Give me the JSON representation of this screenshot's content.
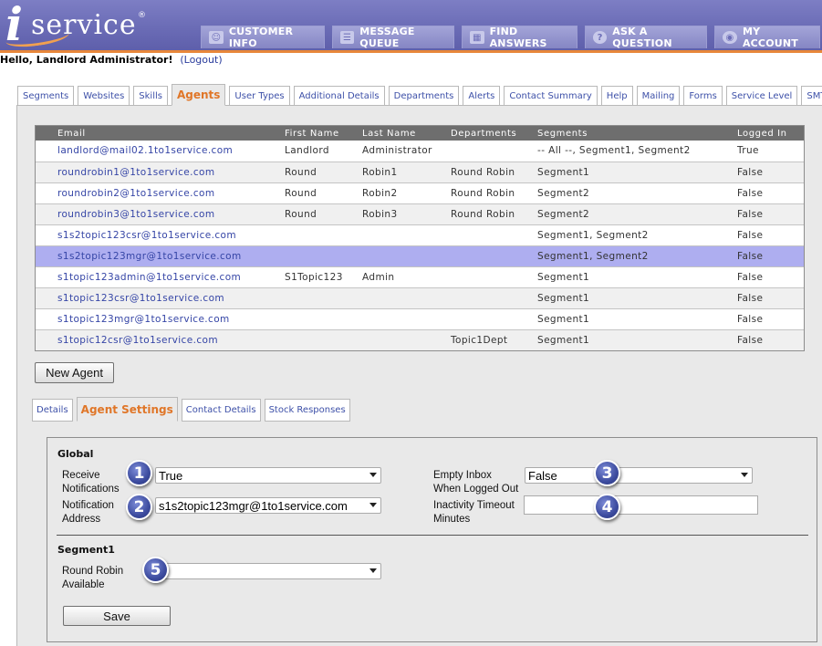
{
  "header": {
    "logo_i": "i",
    "logo_text": "service",
    "logo_reg": "®",
    "nav": [
      {
        "label": "CUSTOMER INFO",
        "icon": "people-icon"
      },
      {
        "label": "MESSAGE QUEUE",
        "icon": "document-icon"
      },
      {
        "label": "FIND ANSWERS",
        "icon": "book-icon"
      },
      {
        "label": "ASK A QUESTION",
        "icon": "question-icon"
      },
      {
        "label": "MY ACCOUNT",
        "icon": "eye-icon"
      }
    ],
    "greeting": "Hello, Landlord Administrator!",
    "logout_open": "(",
    "logout_label": "Logout",
    "logout_close": ")"
  },
  "tabs": [
    {
      "label": "Segments"
    },
    {
      "label": "Websites"
    },
    {
      "label": "Skills"
    },
    {
      "label": "Agents",
      "active": true
    },
    {
      "label": "User Types"
    },
    {
      "label": "Additional Details"
    },
    {
      "label": "Departments"
    },
    {
      "label": "Alerts"
    },
    {
      "label": "Contact Summary"
    },
    {
      "label": "Help"
    },
    {
      "label": "Mailing"
    },
    {
      "label": "Forms"
    },
    {
      "label": "Service Level"
    },
    {
      "label": "SMTP Out"
    }
  ],
  "table": {
    "columns": [
      "Email",
      "First Name",
      "Last Name",
      "Departments",
      "Segments",
      "Logged In"
    ],
    "rows": [
      [
        "landlord@mail02.1to1service.com",
        "Landlord",
        "Administrator",
        "",
        "-- All --, Segment1, Segment2",
        "True"
      ],
      [
        "roundrobin1@1to1service.com",
        "Round",
        "Robin1",
        "Round Robin",
        "Segment1",
        "False"
      ],
      [
        "roundrobin2@1to1service.com",
        "Round",
        "Robin2",
        "Round Robin",
        "Segment2",
        "False"
      ],
      [
        "roundrobin3@1to1service.com",
        "Round",
        "Robin3",
        "Round Robin",
        "Segment2",
        "False"
      ],
      [
        "s1s2topic123csr@1to1service.com",
        "",
        "",
        "",
        "Segment1, Segment2",
        "False"
      ],
      [
        "s1s2topic123mgr@1to1service.com",
        "",
        "",
        "",
        "Segment1, Segment2",
        "False"
      ],
      [
        "s1topic123admin@1to1service.com",
        "S1Topic123",
        "Admin",
        "",
        "Segment1",
        "False"
      ],
      [
        "s1topic123csr@1to1service.com",
        "",
        "",
        "",
        "Segment1",
        "False"
      ],
      [
        "s1topic123mgr@1to1service.com",
        "",
        "",
        "",
        "Segment1",
        "False"
      ],
      [
        "s1topic12csr@1to1service.com",
        "",
        "",
        "Topic1Dept",
        "Segment1",
        "False"
      ]
    ],
    "selected_row": 5
  },
  "new_agent_label": "New Agent",
  "subtabs": [
    {
      "label": "Details"
    },
    {
      "label": "Agent Settings",
      "active": true
    },
    {
      "label": "Contact Details"
    },
    {
      "label": "Stock Responses"
    }
  ],
  "settings": {
    "global_title": "Global",
    "receive_notifications_label_1": "Receive",
    "receive_notifications_label_2": "Notifications",
    "receive_notifications_value": "True",
    "notification_address_label_1": "Notification",
    "notification_address_label_2": "Address",
    "notification_address_value": "s1s2topic123mgr@1to1service.com",
    "empty_inbox_label_1": "Empty Inbox",
    "empty_inbox_label_2": "When Logged Out",
    "empty_inbox_value": "False",
    "inactivity_label_1": "Inactivity Timeout",
    "inactivity_label_2": "Minutes",
    "inactivity_value": "",
    "segment_title": "Segment1",
    "round_robin_label_1": "Round Robin",
    "round_robin_label_2": "Available",
    "round_robin_value": "",
    "save_label": "Save"
  },
  "badges": [
    "1",
    "2",
    "3",
    "4",
    "5"
  ]
}
